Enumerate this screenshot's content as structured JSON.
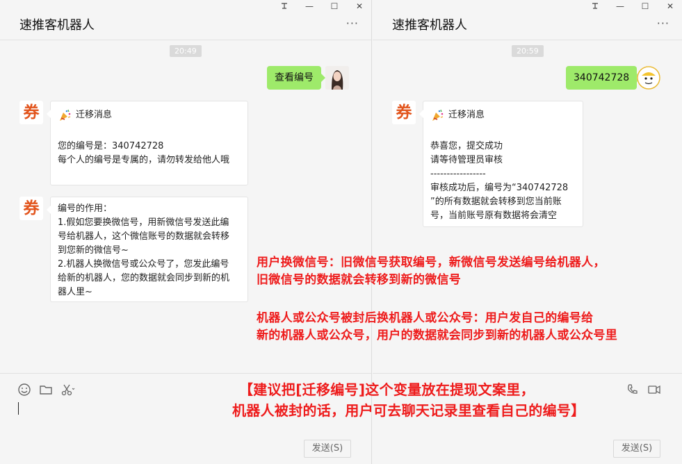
{
  "left": {
    "title": "速推客机器人",
    "more": "···",
    "ctrl": {
      "pin": "〇",
      "min": "—",
      "max": "☐",
      "close": "✕"
    },
    "timestamp": "20:49",
    "sent": "查看编号",
    "card1": {
      "head": "迁移消息",
      "lines": [
        "您的编号是：340742728",
        "每个人的编号是专属的，请勿转发给他人哦"
      ]
    },
    "card2": {
      "lines": [
        "编号的作用：",
        "1.假如您要换微信号，用新微信号发送此编",
        "号给机器人，这个微信账号的数据就会转移",
        "到您新的微信号~",
        "2.机器人换微信号或公众号了，您发此编号",
        "给新的机器人，您的数据就会同步到新的机",
        "器人里~"
      ]
    },
    "avatar_text": "券",
    "send": "发送(S)"
  },
  "right": {
    "title": "速推客机器人",
    "more": "···",
    "ctrl": {
      "pin": "〇",
      "min": "—",
      "max": "☐",
      "close": "✕"
    },
    "timestamp": "20:59",
    "sent": "340742728",
    "card": {
      "head": "迁移消息",
      "lines": [
        "恭喜您，提交成功",
        "请等待管理员审核",
        "-----------------",
        "审核成功后，编号为“340742728",
        "”的所有数据就会转移到您当前账",
        "号，当前账号原有数据将会清空"
      ]
    },
    "avatar_text": "券",
    "send": "发送(S)"
  },
  "annotations": {
    "a1": [
      "用户换微信号：旧微信号获取编号，新微信号发送编号给机器人，",
      "旧微信号的数据就会转移到新的微信号"
    ],
    "a2": [
      "机器人或公众号被封后换机器人或公众号：用户发自己的编号给",
      "新的机器人或公众号，用户的数据就会同步到新的机器人或公众号里"
    ],
    "a3": [
      "【建议把[迁移编号]这个变量放在提现文案里，",
      "机器人被封的话，用户可去聊天记录里查看自己的编号】"
    ]
  },
  "colors": {
    "accent": "#ee1c1c",
    "bubble": "#9eea6a",
    "brand": "#e2541c"
  }
}
